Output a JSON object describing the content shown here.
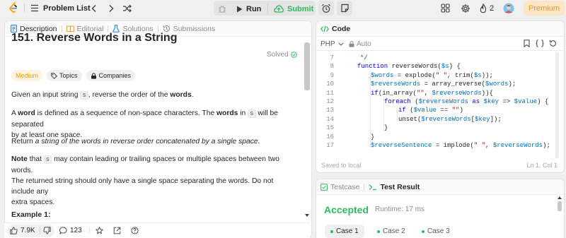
{
  "topbar": {
    "problem_list_label": "Problem List",
    "run_label": "Run",
    "submit_label": "Submit",
    "streak_count": "2",
    "premium_label": "Premium"
  },
  "left_tabs": [
    {
      "label": "Description"
    },
    {
      "label": "Editorial"
    },
    {
      "label": "Solutions"
    },
    {
      "label": "Submissions"
    }
  ],
  "problem": {
    "title": "151. Reverse Words in a String",
    "solved_label": "Solved",
    "difficulty": "Medium",
    "topics_label": "Topics",
    "companies_label": "Companies",
    "p1_a": "Given an input string ",
    "p1_code": "s",
    "p1_b": ", reverse the order of the ",
    "p1_bold": "words",
    "p1_c": ".",
    "p2_a": "A ",
    "p2_bold1": "word",
    "p2_b": " is defined as a sequence of non-space characters. The ",
    "p2_bold2": "words",
    "p2_c": " in ",
    "p2_code": "s",
    "p2_d": " will be separated",
    "p2_e": "by at least one space.",
    "p3_a": "Return ",
    "p3_italic": "a string of the words in reverse order concatenated by a single space.",
    "p4_bold": "Note",
    "p4_a": " that ",
    "p4_code": "s",
    "p4_b": " may contain leading or trailing spaces or multiple spaces between two words.",
    "p4_c": "The returned string should only have a single space separating the words. Do not include any",
    "p4_d": "extra spaces.",
    "example_label": "Example 1:"
  },
  "footer": {
    "likes": "7.9K",
    "comments": "123"
  },
  "code_panel": {
    "tab_label": "Code",
    "language": "PHP",
    "auto_label": "Auto",
    "saved_label": "Saved to local",
    "cursor_pos": "Ln 1, Col 1",
    "lines": [
      {
        "n": "7"
      },
      {
        "n": "8"
      },
      {
        "n": "9"
      },
      {
        "n": "10"
      },
      {
        "n": "11"
      },
      {
        "n": "12"
      },
      {
        "n": "13"
      },
      {
        "n": "14"
      },
      {
        "n": "15"
      },
      {
        "n": "16"
      },
      {
        "n": "17"
      }
    ],
    "code": {
      "l7": "*/",
      "l8_kw": "function",
      "l8_rest": " reverseWords(",
      "l8_var": "$s",
      "l8_end": ") {",
      "l9_var": "$words",
      "l9_a": " = explode(",
      "l9_str": "\" \"",
      "l9_b": ", trim(",
      "l9_var2": "$s",
      "l9_c": "));",
      "l10_var": "$reverseWords",
      "l10_a": " = array_reverse(",
      "l10_var2": "$words",
      "l10_b": ");",
      "l11_kw": "if",
      "l11_a": "(in_array(",
      "l11_str": "\"\"",
      "l11_b": ", ",
      "l11_var": "$reverseWords",
      "l11_c": ")){",
      "l12_kw": "foreach",
      "l12_a": " (",
      "l12_var": "$reverseWords",
      "l12_kw2": " as ",
      "l12_var2": "$key",
      "l12_b": " => ",
      "l12_var3": "$value",
      "l12_c": ") {",
      "l13_kw": "if",
      "l13_a": " (",
      "l13_var": "$value",
      "l13_b": " == ",
      "l13_str": "\"\"",
      "l13_c": ")",
      "l14_a": "unset(",
      "l14_var": "$reverseWords",
      "l14_b": "[",
      "l14_var2": "$key",
      "l14_c": "]);",
      "l15": "}",
      "l16": "}",
      "l17_var": "$reverseSentence",
      "l17_a": " = implode(",
      "l17_str": "\" \"",
      "l17_b": ", ",
      "l17_var2": "$reverseWords",
      "l17_c": ");"
    }
  },
  "result_panel": {
    "testcase_label": "Testcase",
    "test_result_label": "Test Result",
    "status": "Accepted",
    "runtime": "Runtime: 17 ms",
    "cases": [
      {
        "label": "Case 1"
      },
      {
        "label": "Case 2"
      },
      {
        "label": "Case 3"
      }
    ]
  },
  "colors": {
    "accepted_green": "#2cbb5d",
    "submit_green": "#2cbb5d",
    "premium_orange": "#e59a2f",
    "medium_orange": "#f0a020"
  }
}
